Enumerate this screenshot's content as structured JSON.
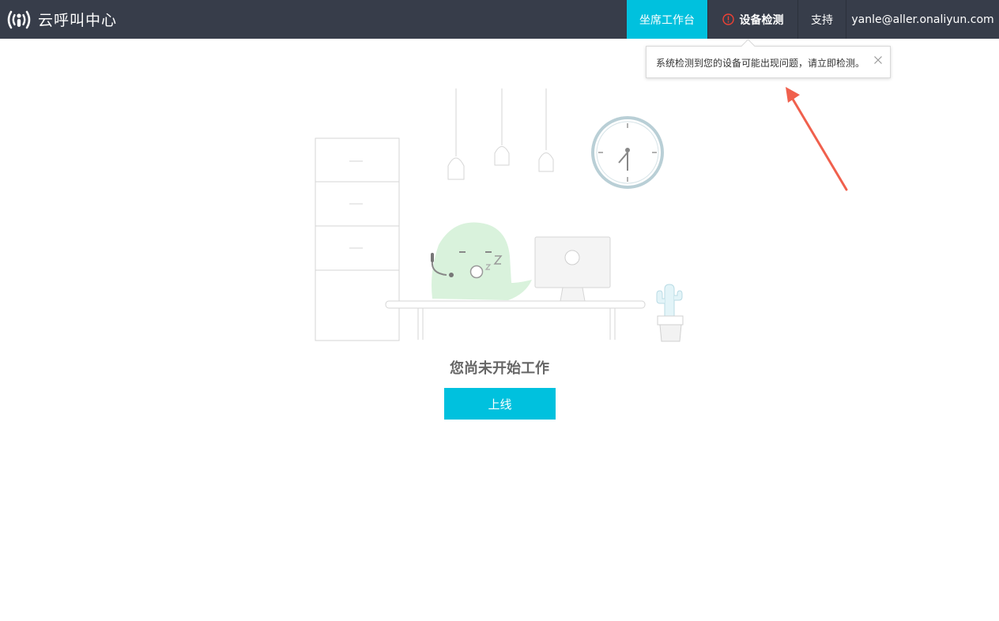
{
  "header": {
    "app_title": "云呼叫中心",
    "logo_icon": "signal-person-icon",
    "nav": {
      "workbench": "坐席工作台",
      "device_check": "设备检测",
      "support": "支持",
      "user_email": "yanle@aller.onaliyun.com"
    }
  },
  "popover": {
    "message": "系统检测到您的设备可能出现问题，请立即检测。",
    "close_icon": "close-icon"
  },
  "main": {
    "status_text": "您尚未开始工作",
    "online_button": "上线"
  },
  "colors": {
    "topbar": "#373d4a",
    "accent": "#00c1de",
    "warning": "#f04134",
    "annotation_arrow": "#f0604d"
  }
}
